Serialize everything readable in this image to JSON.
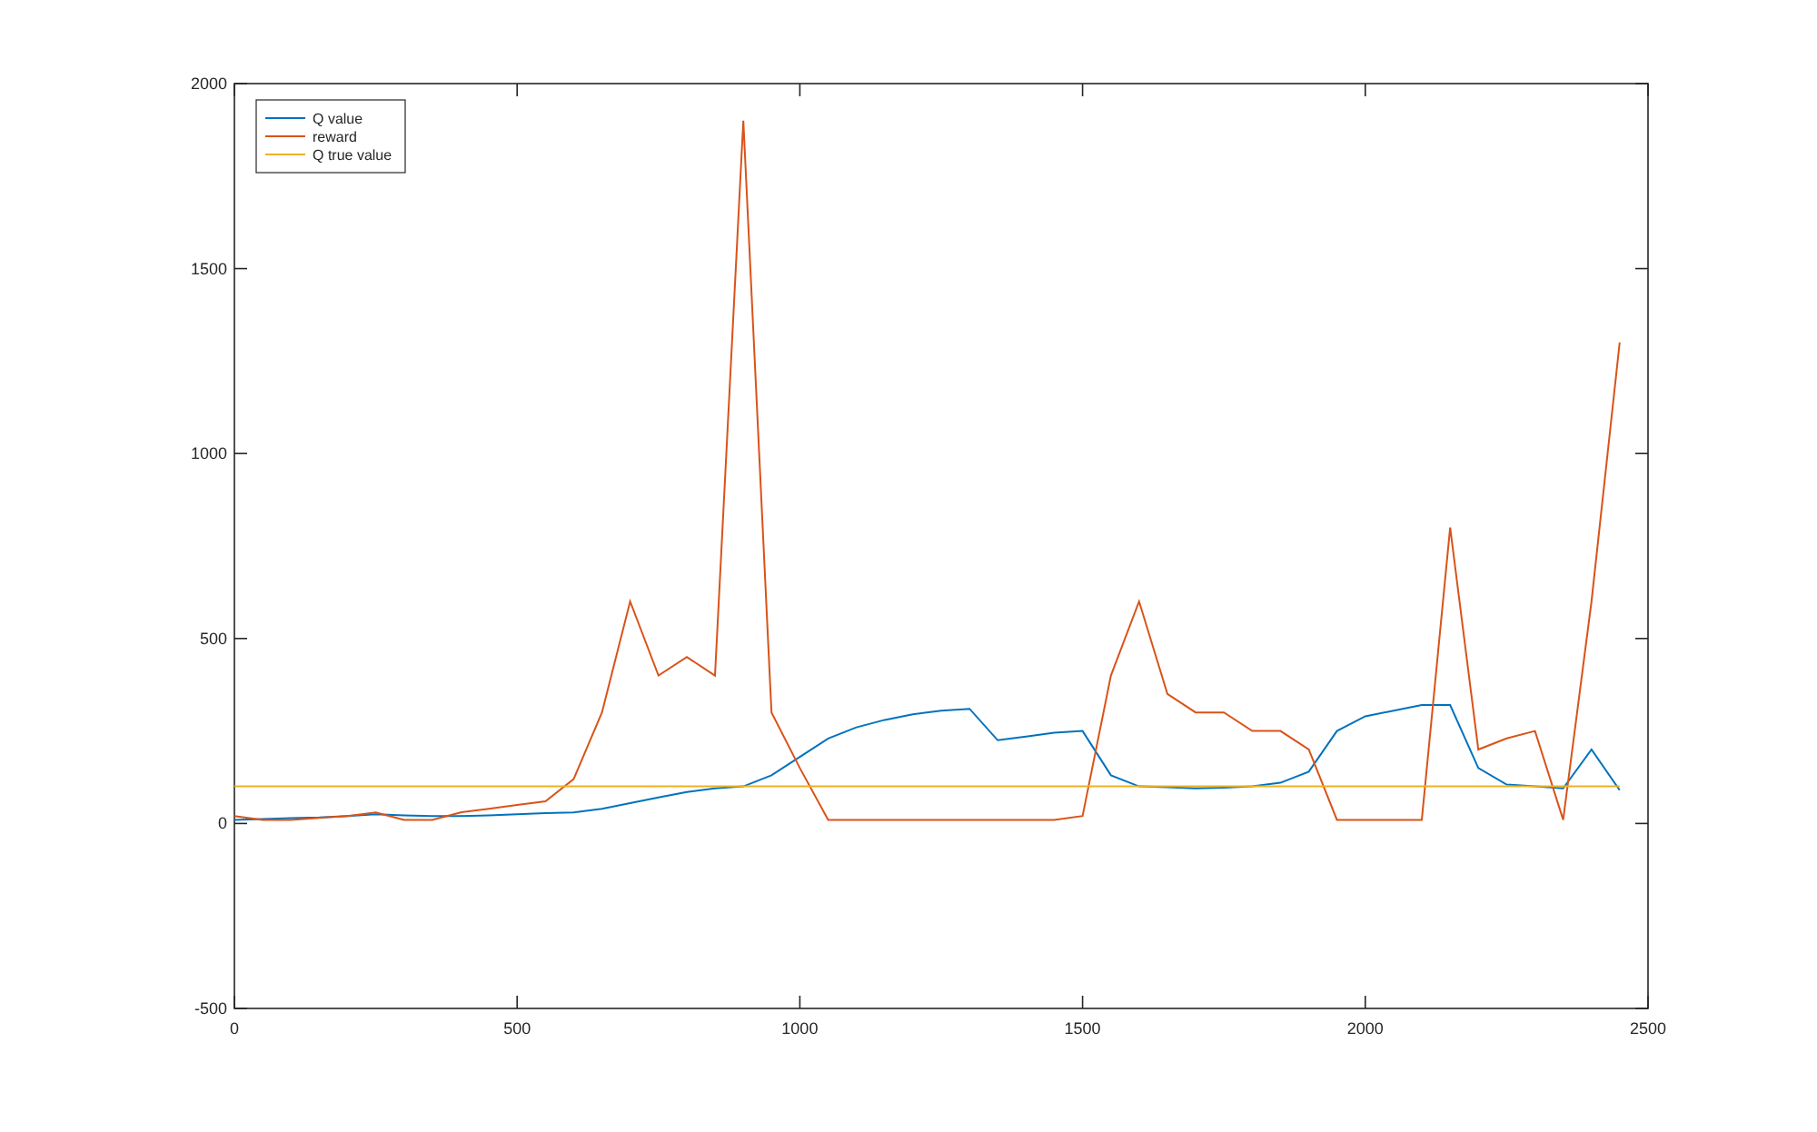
{
  "figure": {
    "chart_data": {
      "type": "line",
      "x": [
        0,
        50,
        100,
        150,
        200,
        250,
        300,
        350,
        400,
        450,
        500,
        550,
        600,
        650,
        700,
        750,
        800,
        850,
        900,
        950,
        1000,
        1050,
        1100,
        1150,
        1200,
        1250,
        1300,
        1350,
        1400,
        1450,
        1500,
        1550,
        1600,
        1650,
        1700,
        1750,
        1800,
        1850,
        1900,
        1950,
        2000,
        2050,
        2100,
        2150,
        2200,
        2250,
        2300,
        2350,
        2400,
        2450
      ],
      "series": [
        {
          "name": "Q value",
          "color": "#0072bd",
          "values": [
            10,
            12,
            14,
            16,
            20,
            25,
            22,
            20,
            20,
            22,
            25,
            28,
            30,
            40,
            55,
            70,
            85,
            95,
            100,
            130,
            180,
            230,
            260,
            280,
            295,
            305,
            310,
            225,
            235,
            245,
            250,
            130,
            100,
            98,
            95,
            97,
            100,
            110,
            140,
            250,
            290,
            305,
            320,
            320,
            150,
            105,
            100,
            95,
            200,
            90
          ]
        },
        {
          "name": "reward",
          "color": "#d95319",
          "values": [
            20,
            10,
            10,
            15,
            20,
            30,
            10,
            10,
            30,
            40,
            50,
            60,
            120,
            300,
            600,
            400,
            450,
            400,
            1900,
            300,
            150,
            10,
            10,
            10,
            10,
            10,
            10,
            10,
            10,
            10,
            20,
            400,
            600,
            350,
            300,
            300,
            250,
            250,
            200,
            10,
            10,
            10,
            10,
            800,
            200,
            230,
            250,
            10,
            600,
            1300
          ]
        },
        {
          "name": "Q true value",
          "color": "#edb120",
          "values": [
            100,
            100,
            100,
            100,
            100,
            100,
            100,
            100,
            100,
            100,
            100,
            100,
            100,
            100,
            100,
            100,
            100,
            100,
            100,
            100,
            100,
            100,
            100,
            100,
            100,
            100,
            100,
            100,
            100,
            100,
            100,
            100,
            100,
            100,
            100,
            100,
            100,
            100,
            100,
            100,
            100,
            100,
            100,
            100,
            100,
            100,
            100,
            100,
            100,
            100
          ]
        }
      ],
      "legend": true,
      "xlim": [
        0,
        2500
      ],
      "ylim": [
        -500,
        2000
      ],
      "xticks": [
        0,
        500,
        1000,
        1500,
        2000,
        2500
      ],
      "yticks": [
        -500,
        0,
        500,
        1000,
        1500,
        2000
      ]
    }
  }
}
